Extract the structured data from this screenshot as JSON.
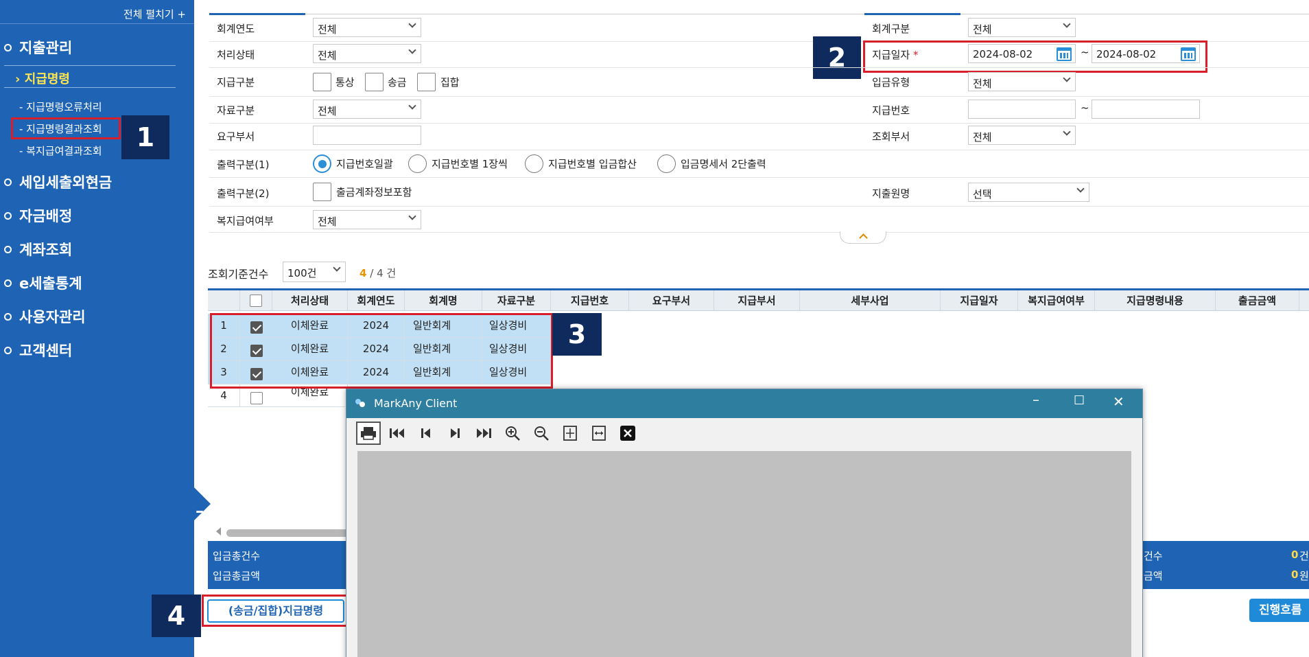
{
  "sidebar": {
    "expand_all": "전체 펼치기 +",
    "menus": [
      "지출관리",
      "세입세출외현금",
      "자금배정",
      "계좌조회",
      "e세출통계",
      "사용자관리",
      "고객센터"
    ],
    "submenu": "지급명령",
    "leaves": [
      "- 지급명령오류처리",
      "- 지급명령결과조회",
      "- 복지급여결과조회"
    ]
  },
  "badges": [
    "1",
    "2",
    "3",
    "4"
  ],
  "form": {
    "fiscal_year_label": "회계연도",
    "fiscal_year": "전체",
    "account_type_label": "회계구분",
    "account_type": "전체",
    "status_label": "처리상태",
    "status": "전체",
    "pay_date_label": "지급일자",
    "pay_date_req": "*",
    "pay_date_from": "2024-08-02",
    "pay_date_to": "2024-08-02",
    "pay_type_label": "지급구분",
    "pay_type_opts": [
      "통상",
      "송금",
      "집합"
    ],
    "deposit_type_label": "입금유형",
    "deposit_type": "전체",
    "data_type_label": "자료구분",
    "data_type": "전체",
    "pay_no_label": "지급번호",
    "tilde": "~",
    "req_dept_label": "요구부서",
    "query_dept_label": "조회부서",
    "query_dept": "전체",
    "output1_label": "출력구분(1)",
    "output1_opts": [
      "지급번호일괄",
      "지급번호별 1장씩",
      "지급번호별 입금합산",
      "입금명세서 2단출력"
    ],
    "output2_label": "출력구분(2)",
    "output2_opt": "출금계좌정보포함",
    "disburse_label": "지출원명",
    "disburse": "선택",
    "welfare_label": "복지급여여부",
    "welfare": "전체"
  },
  "grid": {
    "count_label": "조회기준건수",
    "count_sel": "100건",
    "count_cur": "4",
    "count_sep": "/",
    "count_total": "4",
    "count_unit": "건",
    "headers": [
      "처리상태",
      "회계연도",
      "회계명",
      "자료구분",
      "지급번호",
      "요구부서",
      "지급부서",
      "세부사업",
      "지급일자",
      "복지급여여부",
      "지급명령내용",
      "출금금액"
    ],
    "rows": [
      {
        "no": "1",
        "status": "이체완료",
        "year": "2024",
        "acct": "일반회계",
        "kind": "일상경비"
      },
      {
        "no": "2",
        "status": "이체완료",
        "year": "2024",
        "acct": "일반회계",
        "kind": "일상경비"
      },
      {
        "no": "3",
        "status": "이체완료",
        "year": "2024",
        "acct": "일반회계",
        "kind": "일상경비"
      },
      {
        "no": "4",
        "status": "이체완료"
      }
    ]
  },
  "summary": {
    "dep_count_label": "입금총건수",
    "dep_amt_label": "입금총금액",
    "r_count_label": "건수",
    "r_amt_label": "금액",
    "r_count": "0",
    "r_count_unit": "건",
    "r_amt": "0",
    "r_amt_unit": "원"
  },
  "buttons": {
    "transfer": "(송금/집합)지급명령",
    "flow": "진행흐름"
  },
  "popup": {
    "title": "MarkAny Client"
  }
}
